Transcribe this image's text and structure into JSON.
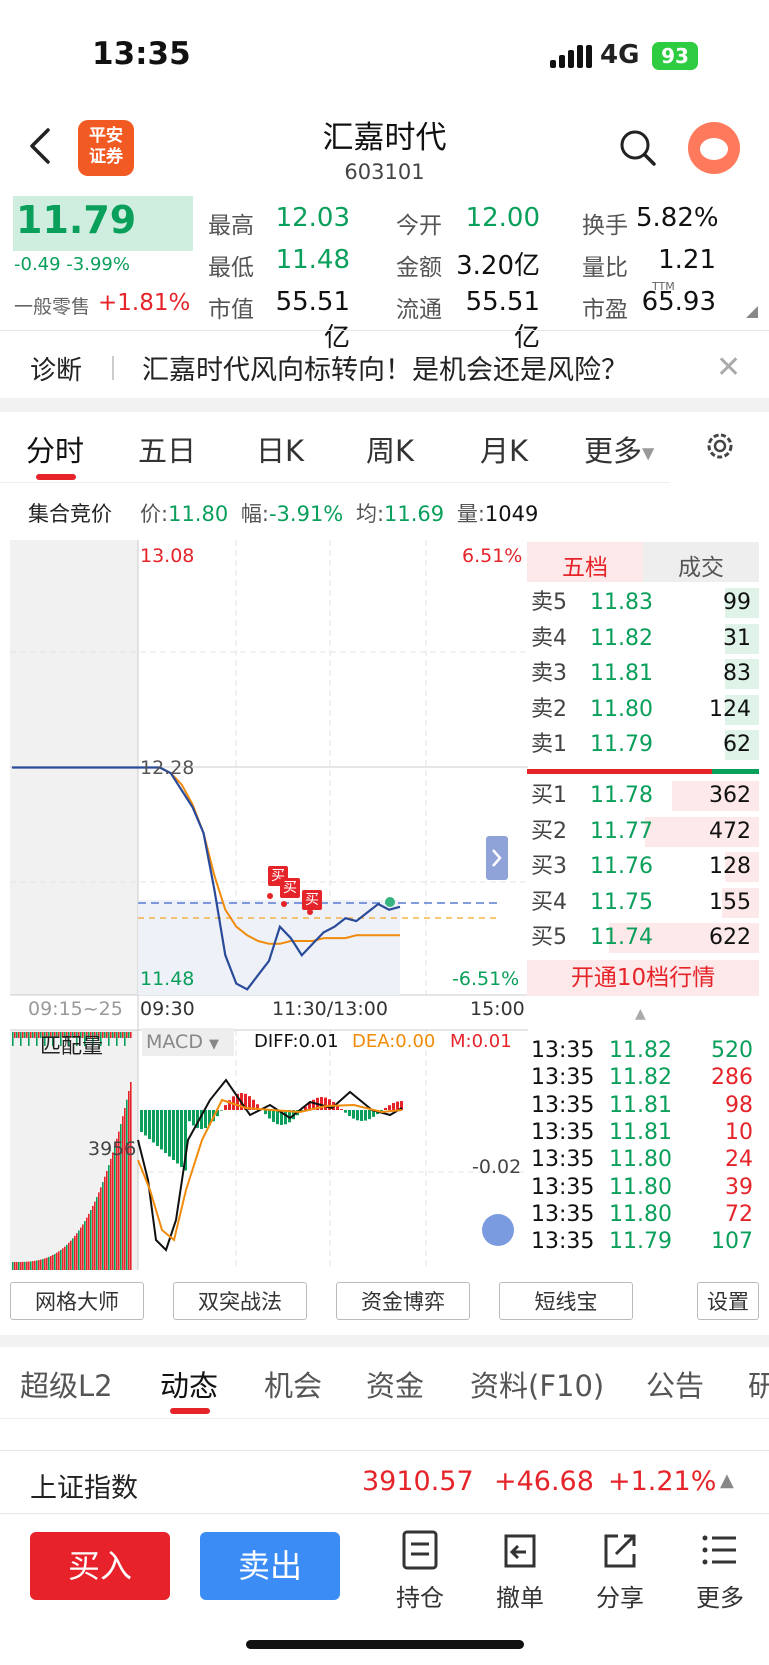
{
  "status_bar": {
    "time": "13:35",
    "network": "4G",
    "battery": "93"
  },
  "header": {
    "broker_logo": "平安\n证券",
    "title": "汇嘉时代",
    "code": "603101",
    "back_icon": "chevron-left-icon",
    "search_icon": "search-icon",
    "avatar_icon": "avatar"
  },
  "quote": {
    "price": "11.79",
    "change": "-0.49 -3.99%",
    "retail_label": "一般零售",
    "retail_value": "+1.81%",
    "fields": [
      {
        "label": "最高",
        "value": "12.03",
        "color": "#0a9f5a"
      },
      {
        "label": "今开",
        "value": "12.00",
        "color": "#0a9f5a"
      },
      {
        "label": "换手",
        "value": "5.82%",
        "color": "#111111"
      },
      {
        "label": "最低",
        "value": "11.48",
        "color": "#0a9f5a"
      },
      {
        "label": "金额",
        "value": "3.20亿",
        "color": "#111111"
      },
      {
        "label": "量比",
        "value": "1.21",
        "color": "#111111"
      },
      {
        "label": "市值",
        "value": "55.51亿",
        "color": "#111111"
      },
      {
        "label": "流通",
        "value": "55.51亿",
        "color": "#111111"
      },
      {
        "label": "市盈",
        "value": "65.93",
        "color": "#111111"
      }
    ],
    "pe_superscript": "TTM"
  },
  "diagnosis": {
    "label": "诊断",
    "text": "汇嘉时代风向标转向！是机会还是风险？",
    "close_icon": "close-icon"
  },
  "chart_tabs": [
    "分时",
    "五日",
    "日K",
    "周K",
    "月K",
    "更多"
  ],
  "auction": {
    "label": "集合竞价",
    "price_label": "价:",
    "price": "11.80",
    "amp_label": "幅:",
    "amp": "-3.91%",
    "avg_label": "均:",
    "avg": "11.69",
    "vol_label": "量:",
    "vol": "1049"
  },
  "intraday": {
    "y_top": "13.08",
    "y_mid": "12.28",
    "y_bottom": "11.48",
    "pct_top": "6.51%",
    "pct_bottom": "-6.51%",
    "x_pre": "09:15~25",
    "x_start": "09:30",
    "x_mid": "11:30/13:00",
    "x_end": "15:00",
    "buy_marker": "买",
    "match_label": "匹配量",
    "match_value": "3956",
    "macd_selector": "MACD",
    "diff": "DIFF:0.01",
    "dea": "DEA:0.00",
    "m": "M:0.01",
    "macd_low": "-0.02"
  },
  "chart_data": {
    "type": "line",
    "title": "",
    "ylim": [
      11.48,
      13.08
    ],
    "series": [
      {
        "name": "价",
        "values": [
          12.28,
          12.28,
          12.28,
          12.26,
          12.2,
          12.14,
          12.05,
          11.85,
          11.62,
          11.52,
          11.5,
          11.55,
          11.6,
          11.72,
          11.68,
          11.62,
          11.66,
          11.7,
          11.72,
          11.75,
          11.74,
          11.77,
          11.8,
          11.78,
          11.79
        ]
      },
      {
        "name": "均",
        "values": [
          12.28,
          12.28,
          12.28,
          12.26,
          12.22,
          12.15,
          12.05,
          11.9,
          11.78,
          11.72,
          11.69,
          11.67,
          11.66,
          11.66,
          11.67,
          11.67,
          11.67,
          11.68,
          11.68,
          11.68,
          11.69,
          11.69,
          11.69,
          11.69,
          11.69
        ]
      }
    ]
  },
  "order_book": {
    "tabs": [
      "五档",
      "成交"
    ],
    "asks": [
      {
        "label": "卖5",
        "price": "11.83",
        "vol": "99",
        "ratio": 0.16
      },
      {
        "label": "卖4",
        "price": "11.82",
        "vol": "31",
        "ratio": 0.05
      },
      {
        "label": "卖3",
        "price": "11.81",
        "vol": "83",
        "ratio": 0.13
      },
      {
        "label": "卖2",
        "price": "11.80",
        "vol": "124",
        "ratio": 0.2
      },
      {
        "label": "卖1",
        "price": "11.79",
        "vol": "62",
        "ratio": 0.1
      }
    ],
    "bids": [
      {
        "label": "买1",
        "price": "11.78",
        "vol": "362",
        "ratio": 0.58
      },
      {
        "label": "买2",
        "price": "11.77",
        "vol": "472",
        "ratio": 0.76
      },
      {
        "label": "买3",
        "price": "11.76",
        "vol": "128",
        "ratio": 0.21
      },
      {
        "label": "买4",
        "price": "11.75",
        "vol": "155",
        "ratio": 0.25
      },
      {
        "label": "买5",
        "price": "11.74",
        "vol": "622",
        "ratio": 1.0
      }
    ],
    "upgrade": "开通10档行情",
    "trades": [
      {
        "time": "13:35",
        "price": "11.82",
        "vol": "520",
        "side": "#0a9f5a"
      },
      {
        "time": "13:35",
        "price": "11.82",
        "vol": "286",
        "side": "#e5242a"
      },
      {
        "time": "13:35",
        "price": "11.81",
        "vol": "98",
        "side": "#e5242a"
      },
      {
        "time": "13:35",
        "price": "11.81",
        "vol": "10",
        "side": "#e5242a"
      },
      {
        "time": "13:35",
        "price": "11.80",
        "vol": "24",
        "side": "#e5242a"
      },
      {
        "time": "13:35",
        "price": "11.80",
        "vol": "39",
        "side": "#e5242a"
      },
      {
        "time": "13:35",
        "price": "11.80",
        "vol": "72",
        "side": "#e5242a"
      },
      {
        "time": "13:35",
        "price": "11.79",
        "vol": "107",
        "side": "#0a9f5a"
      }
    ]
  },
  "tools": [
    "网格大师",
    "双突战法",
    "资金博弈",
    "短线宝",
    "设置"
  ],
  "bottom_tabs": [
    "超级L2",
    "动态",
    "机会",
    "资金",
    "资料(F10)",
    "公告",
    "研"
  ],
  "index": {
    "name": "上证指数",
    "value": "3910.57",
    "change": "+46.68",
    "pct": "+1.21%"
  },
  "actions": {
    "buy": "买入",
    "sell": "卖出",
    "hold": "持仓",
    "cancel": "撤单",
    "share": "分享",
    "more": "更多"
  }
}
